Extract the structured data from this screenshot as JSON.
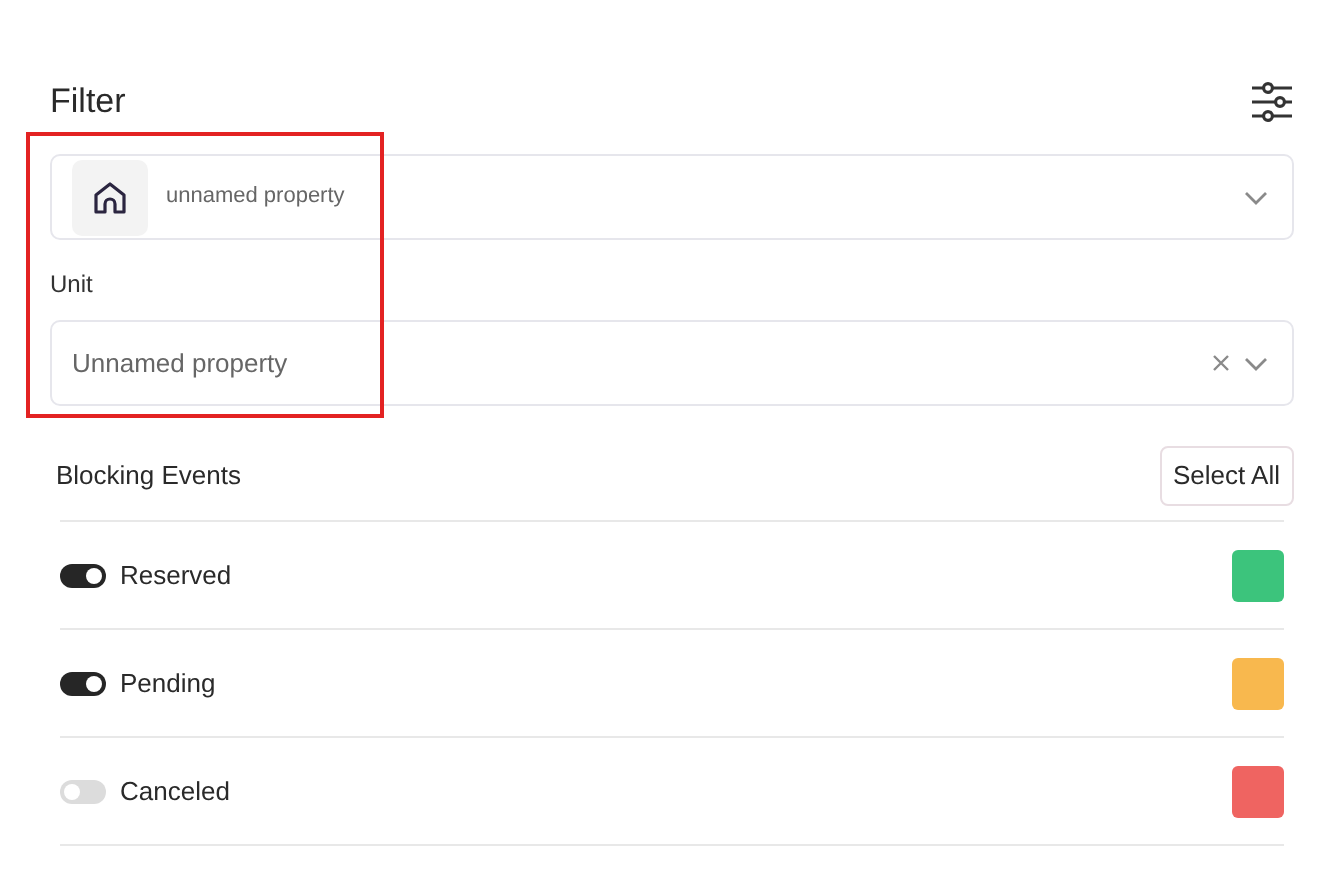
{
  "title": "Filter",
  "property_select": {
    "value": "unnamed property"
  },
  "unit": {
    "label": "Unit",
    "value": "Unnamed property"
  },
  "blocking_events": {
    "title": "Blocking Events",
    "select_all": "Select All",
    "items": [
      {
        "label": "Reserved",
        "on": true,
        "color": "#3cc47c"
      },
      {
        "label": "Pending",
        "on": true,
        "color": "#f8b84e"
      },
      {
        "label": "Canceled",
        "on": false,
        "color": "#ef6461"
      }
    ]
  }
}
